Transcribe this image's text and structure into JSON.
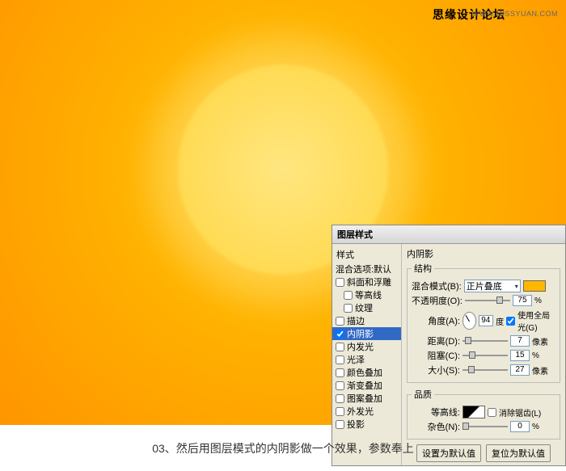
{
  "watermark": {
    "left": "思缘设计论坛",
    "right": "WWW.MISSYUAN.COM"
  },
  "caption": "03、然后用图层模式的内阴影做一个效果，参数奉上",
  "dialog": {
    "title": "图层样式",
    "styles_header": "样式",
    "blend_options": "混合选项:默认",
    "items": [
      {
        "label": "斜面和浮雕",
        "checked": false
      },
      {
        "label": "等高线",
        "checked": false
      },
      {
        "label": "纹理",
        "checked": false
      },
      {
        "label": "描边",
        "checked": false
      },
      {
        "label": "内阴影",
        "checked": true,
        "selected": true
      },
      {
        "label": "内发光",
        "checked": false
      },
      {
        "label": "光泽",
        "checked": false
      },
      {
        "label": "颜色叠加",
        "checked": false
      },
      {
        "label": "渐变叠加",
        "checked": false
      },
      {
        "label": "图案叠加",
        "checked": false
      },
      {
        "label": "外发光",
        "checked": false
      },
      {
        "label": "投影",
        "checked": false
      }
    ],
    "section_title": "内阴影",
    "structure": {
      "legend": "结构",
      "blend_mode_label": "混合模式(B):",
      "blend_mode_value": "正片叠底",
      "opacity_label": "不透明度(O):",
      "opacity_value": "75",
      "opacity_unit": "%",
      "angle_label": "角度(A):",
      "angle_value": "94",
      "angle_unit": "度",
      "global_light_label": "使用全局光(G)",
      "distance_label": "距离(D):",
      "distance_value": "7",
      "distance_unit": "像素",
      "choke_label": "阻塞(C):",
      "choke_value": "15",
      "choke_unit": "%",
      "size_label": "大小(S):",
      "size_value": "27",
      "size_unit": "像素"
    },
    "quality": {
      "legend": "品质",
      "contour_label": "等高线:",
      "antialias_label": "消除锯齿(L)",
      "noise_label": "杂色(N):",
      "noise_value": "0",
      "noise_unit": "%"
    },
    "buttons": {
      "default": "设置为默认值",
      "reset": "复位为默认值"
    }
  }
}
